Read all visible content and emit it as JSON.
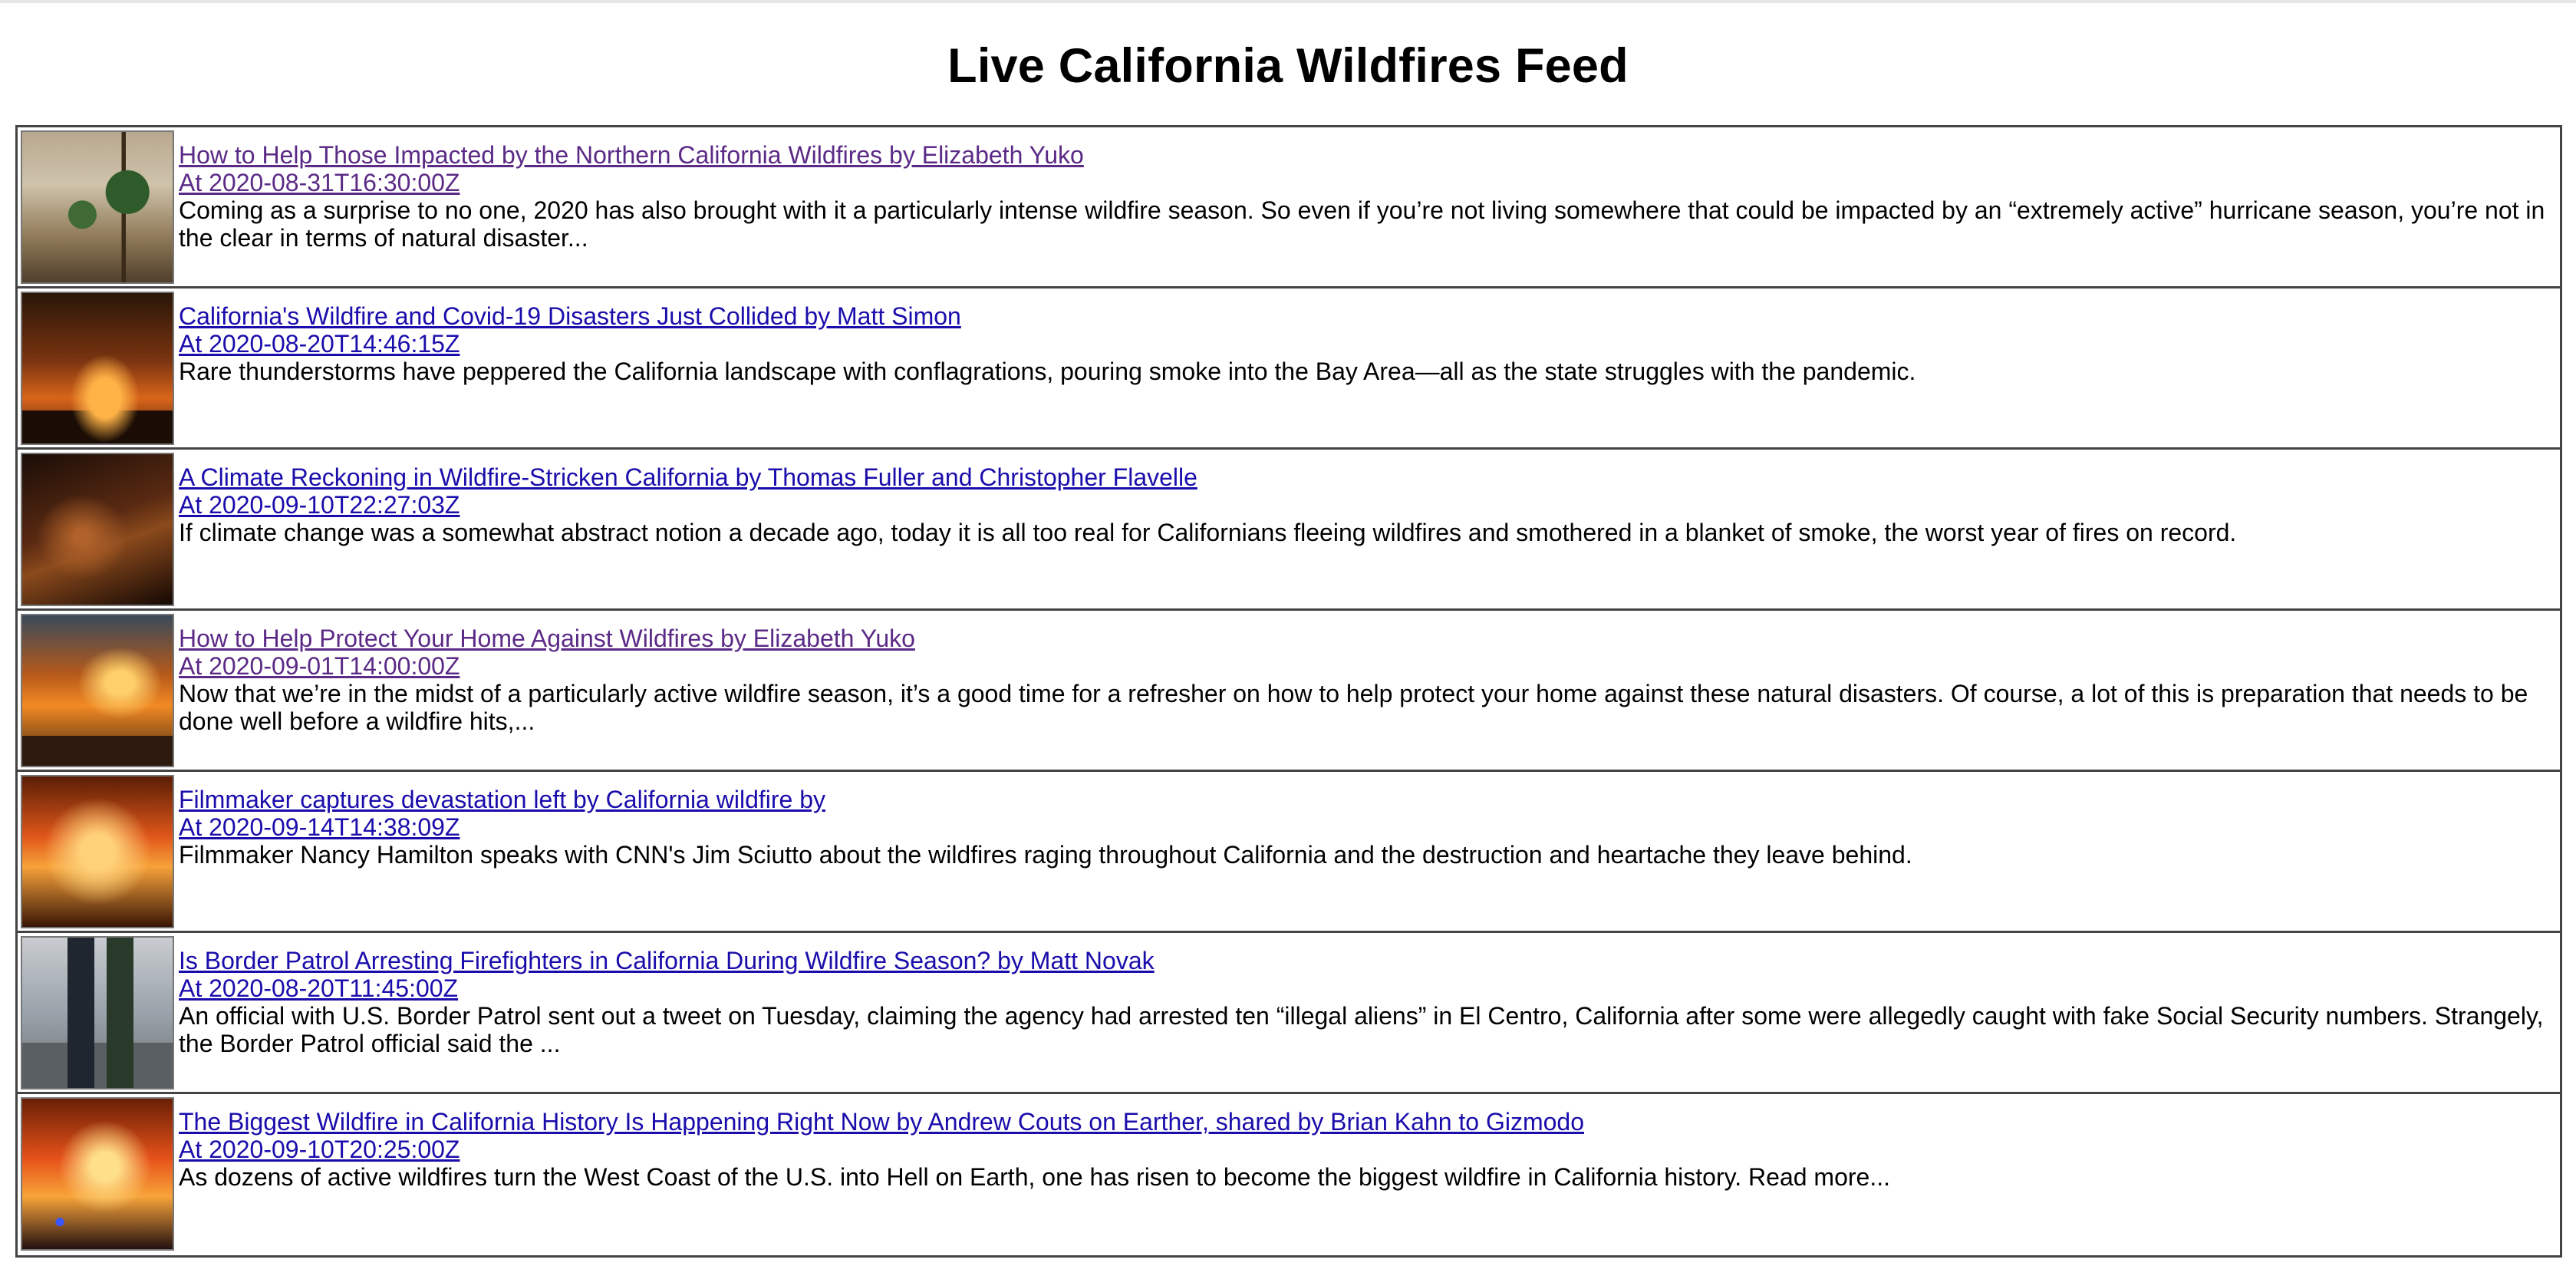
{
  "page": {
    "title": "Live California Wildfires Feed"
  },
  "articles": [
    {
      "title": "How to Help Those Impacted by the Northern California Wildfires by Elizabeth Yuko",
      "timestamp": "At 2020-08-31T16:30:00Z",
      "description": "Coming as a surprise to no one, 2020 has also brought with it a particularly intense wildfire season. So even if you’re not living somewhere that could be impacted by an “extremely active” hurricane season, you’re not in the clear in terms of natural disaster...",
      "visited": true,
      "thumbnail": "palm-tree-smoke-photo"
    },
    {
      "title": "California's Wildfire and Covid-19 Disasters Just Collided by Matt Simon",
      "timestamp": "At 2020-08-20T14:46:15Z",
      "description": "Rare thunderstorms have peppered the California landscape with conflagrations, pouring smoke into the Bay Area—all as the state struggles with the pandemic.",
      "visited": false,
      "thumbnail": "firefighter-night-fire-photo"
    },
    {
      "title": "A Climate Reckoning in Wildfire-Stricken California by Thomas Fuller and Christopher Flavelle",
      "timestamp": "At 2020-09-10T22:27:03Z",
      "description": "If climate change was a somewhat abstract notion a decade ago, today it is all too real for Californians fleeing wildfires and smothered in a blanket of smoke, the worst year of fires on record.",
      "visited": false,
      "thumbnail": "dark-smoke-valley-photo"
    },
    {
      "title": "How to Help Protect Your Home Against Wildfires by Elizabeth Yuko",
      "timestamp": "At 2020-09-01T14:00:00Z",
      "description": "Now that we’re in the midst of a particularly active wildfire season, it’s a good time for a refresher on how to help protect your home against these natural disasters. Of course, a lot of this is preparation that needs to be done well before a wildfire hits,...",
      "visited": true,
      "thumbnail": "burning-house-photo"
    },
    {
      "title": "Filmmaker captures devastation left by California wildfire by",
      "timestamp": "At 2020-09-14T14:38:09Z",
      "description": "Filmmaker Nancy Hamilton speaks with CNN's Jim Sciutto about the wildfires raging throughout California and the destruction and heartache they leave behind.",
      "visited": false,
      "thumbnail": "flames-photo"
    },
    {
      "title": "Is Border Patrol Arresting Firefighters in California During Wildfire Season? by Matt Novak",
      "timestamp": "At 2020-08-20T11:45:00Z",
      "description": "An official with U.S. Border Patrol sent out a tweet on Tuesday, claiming the agency had arrested ten “illegal aliens” in El Centro, California after some were allegedly caught with fake Social Security numbers. Strangely, the Border Patrol official said the ...",
      "visited": false,
      "thumbnail": "border-patrol-agents-photo"
    },
    {
      "title": "The Biggest Wildfire in California History Is Happening Right Now by Andrew Couts on Earther, shared by Brian Kahn to Gizmodo",
      "timestamp": "At 2020-09-10T20:25:00Z",
      "description": "As dozens of active wildfires turn the West Coast of the U.S. into Hell on Earth, one has risen to become the biggest wildfire in California history. Read more...",
      "visited": false,
      "thumbnail": "wildfire-firetruck-photo"
    }
  ]
}
